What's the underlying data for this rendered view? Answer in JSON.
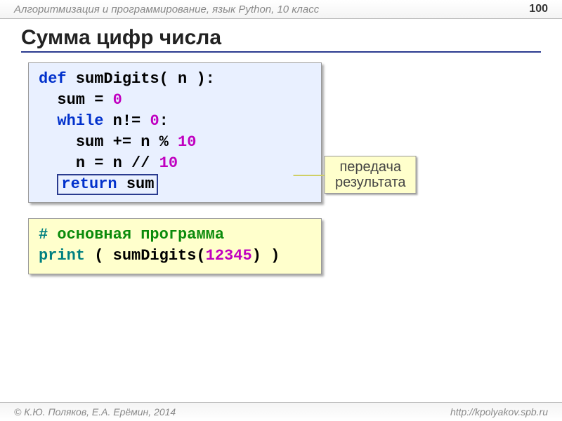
{
  "header": {
    "subject": "Алгоритмизация и программирование, язык Python, 10 класс",
    "page_number": "100"
  },
  "title": "Сумма цифр числа",
  "code1": {
    "l1_def": "def",
    "l1_rest": " sumDigits( n ):",
    "l2_a": "sum = ",
    "l2_zero": "0",
    "l3_while": "while",
    "l3_rest": " n!= ",
    "l3_zero": "0",
    "l3_colon": ":",
    "l4_a": "sum += n % ",
    "l4_ten": "10",
    "l5_a": "n = n // ",
    "l5_ten": "10",
    "l6_ret": "return",
    "l6_sum": " sum"
  },
  "callout": {
    "line1": "передача",
    "line2": "результата"
  },
  "code2": {
    "c_hash": "#",
    "c_comment": " основная программа",
    "p_print": "print",
    "p_open": " ( sumDigits(",
    "p_num": "12345",
    "p_close": ") )"
  },
  "footer": {
    "left": "© К.Ю. Поляков, Е.А. Ерёмин, 2014",
    "right": "http://kpolyakov.spb.ru"
  }
}
